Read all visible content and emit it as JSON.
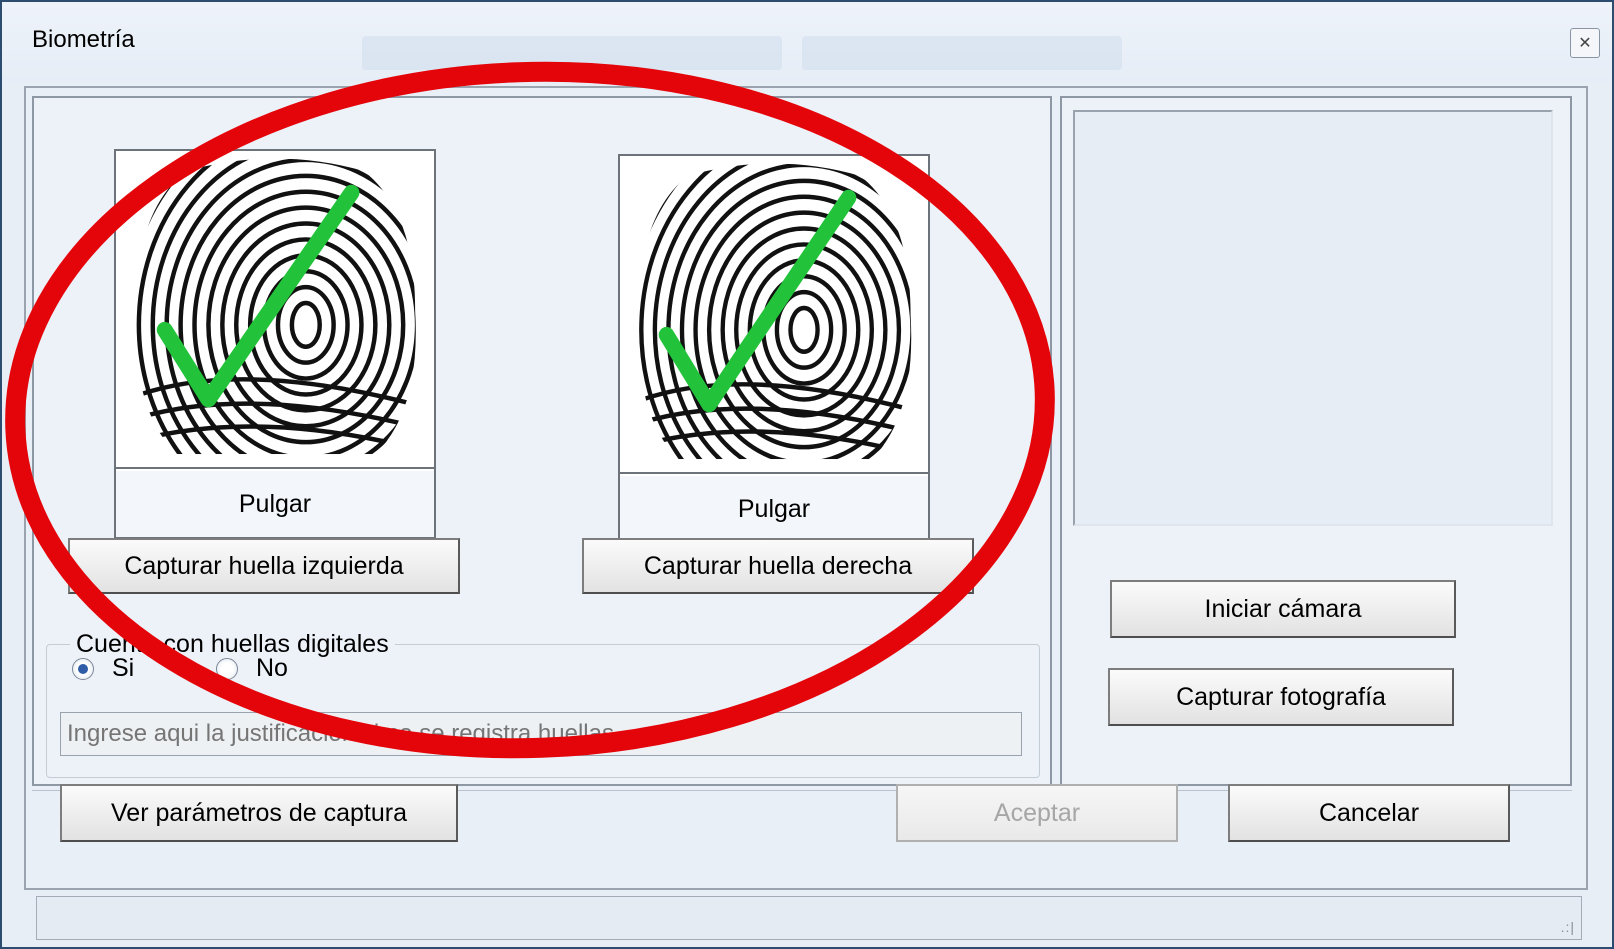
{
  "window": {
    "title": "Biometría",
    "close_icon": "close-icon"
  },
  "fingerprints": {
    "left": {
      "label": "Pulgar",
      "captured": true,
      "button_label": "Capturar huella izquierda"
    },
    "right": {
      "label": "Pulgar",
      "captured": true,
      "button_label": "Capturar huella derecha"
    }
  },
  "has_fingerprints": {
    "legend": "Cuenta con huellas digitales",
    "options": [
      {
        "label": "Si",
        "checked": true
      },
      {
        "label": "No",
        "checked": false
      }
    ],
    "justification_placeholder": "Ingrese aqui la justificación si no se registra huellas."
  },
  "camera": {
    "start_label": "Iniciar cámara",
    "capture_label": "Capturar fotografía"
  },
  "footer": {
    "params_label": "Ver parámetros de captura",
    "accept_label": "Aceptar",
    "cancel_label": "Cancelar"
  },
  "colors": {
    "check_green": "#22c33a",
    "annotation_red": "#e4050a",
    "radio_selected": "#2f5da8"
  }
}
